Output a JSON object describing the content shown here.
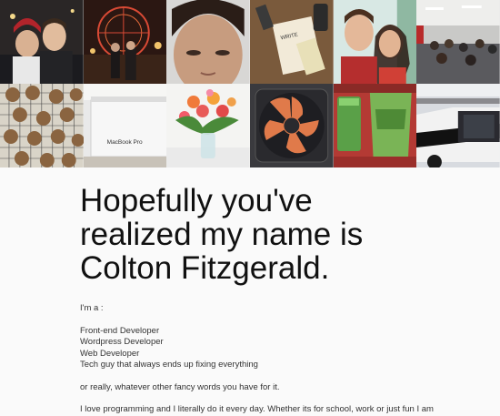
{
  "photos": [
    {
      "name": "selfie-couple-holiday-photo"
    },
    {
      "name": "ferris-wheel-night-photo"
    },
    {
      "name": "close-up-face-photo"
    },
    {
      "name": "notebook-on-table-photo"
    },
    {
      "name": "couple-selfie-red-shirt-photo"
    },
    {
      "name": "conference-room-crowd-photo"
    },
    {
      "name": "cookies-on-rack-photo",
      "label": ""
    },
    {
      "name": "macbook-pro-box-photo",
      "label": "MacBook Pro"
    },
    {
      "name": "flower-vase-photo"
    },
    {
      "name": "orange-cooling-fan-photo"
    },
    {
      "name": "green-smoothie-photo"
    },
    {
      "name": "police-car-photo"
    }
  ],
  "notebook_label": "WRITE",
  "headline": "Hopefully you've realized my name is Colton Fitzgerald.",
  "intro": "I'm a :",
  "roles": [
    "Front-end Developer",
    "Wordpress Developer",
    "Web Developer",
    "Tech guy that always ends up fixing everything"
  ],
  "alt_text": "or really, whatever other fancy words you have for it.",
  "about": "I love programming and I literally do it every day. Whether its for school, work or just fun I am"
}
